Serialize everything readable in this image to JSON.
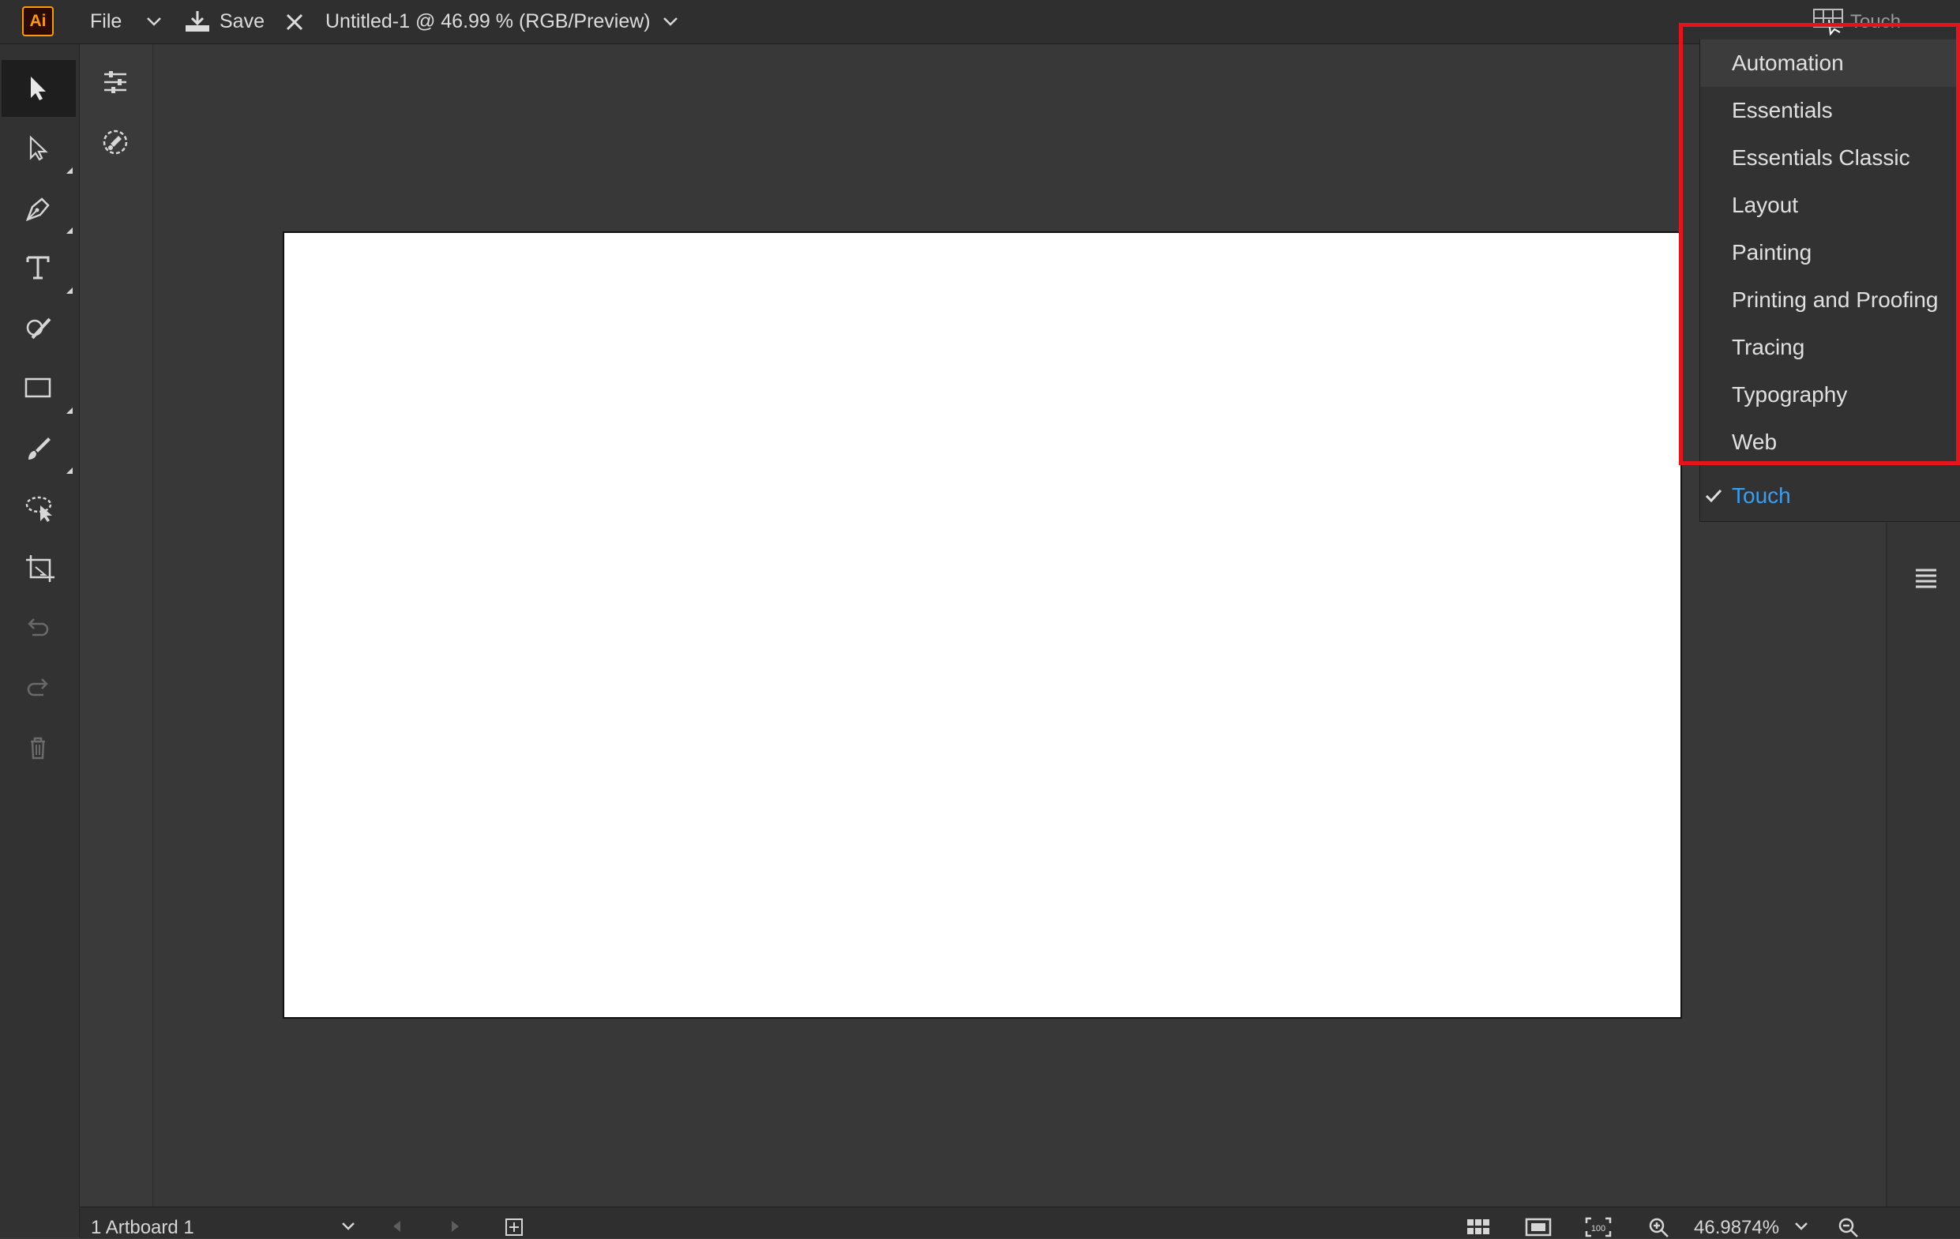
{
  "app": {
    "logo_text": "Ai",
    "accent_color": "#ff9a00"
  },
  "menubar": {
    "file_label": "File",
    "save_label": "Save",
    "document_title": "Untitled-1 @ 46.99 % (RGB/Preview)",
    "workspace_current": "Touch"
  },
  "toolbar": {
    "tools": [
      "selection-tool",
      "direct-selection-tool",
      "pen-tool",
      "type-tool",
      "shaper-tool",
      "rectangle-tool",
      "paintbrush-tool",
      "lasso-selection-tool",
      "artboard-tool",
      "undo",
      "redo",
      "delete"
    ]
  },
  "workspace_menu": {
    "items": [
      "Automation",
      "Essentials",
      "Essentials Classic",
      "Layout",
      "Painting",
      "Printing and Proofing",
      "Tracing",
      "Typography",
      "Web"
    ],
    "current": "Touch",
    "highlight_color": "#e4141c",
    "current_color": "#3a9ef0"
  },
  "statusbar": {
    "artboard_label": "1 Artboard 1",
    "zoom_value": "46.9874%"
  }
}
